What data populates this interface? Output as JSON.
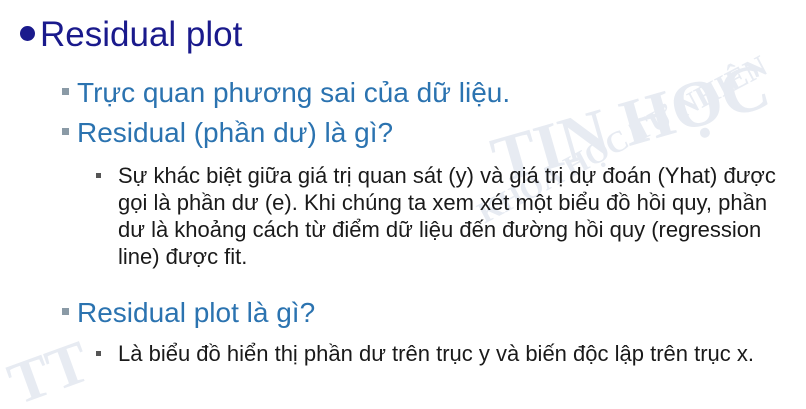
{
  "slide": {
    "title": "Residual plot",
    "items": [
      {
        "text": "Trực quan phương sai của dữ liệu."
      },
      {
        "text": "Residual (phần dư) là gì?"
      },
      {
        "text": "Sự khác biệt giữa giá trị quan sát (y) và giá trị dự đoán (Yhat) được gọi là phần dư (e). Khi chúng ta xem xét một biểu đồ hồi quy, phần dư là khoảng cách từ điểm dữ liệu đến đường hồi quy (regression line) được fit."
      },
      {
        "text": "Residual plot là gì?"
      },
      {
        "text": "Là biểu đồ hiển thị phần dư trên trục y và biến độc lập trên trục x."
      }
    ]
  },
  "watermark": {
    "arc_text": "KHOA HỌC TỰ NHIÊN",
    "main_text": "TIN HỌC",
    "left_text": "TT"
  },
  "colors": {
    "title": "#1a1a8c",
    "level2": "#2b73b0",
    "body": "#1a1a1a",
    "watermark": "#e7ebf2"
  }
}
